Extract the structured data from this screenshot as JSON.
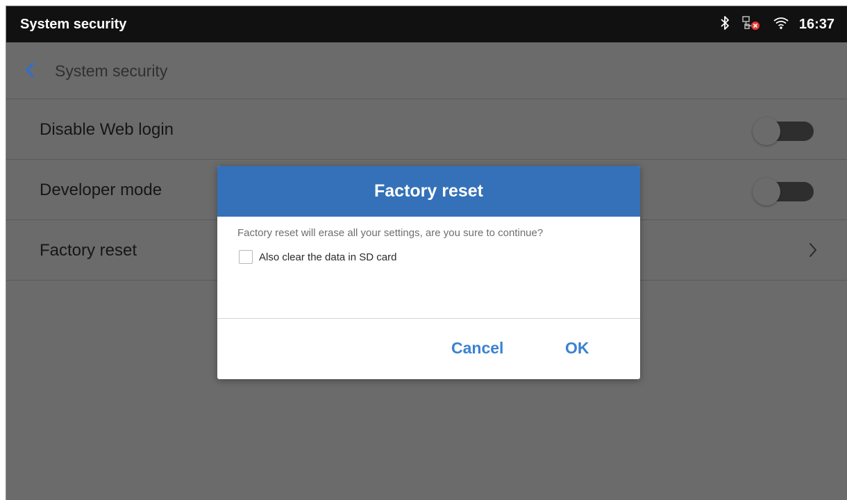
{
  "statusbar": {
    "title": "System security",
    "time": "16:37",
    "icons": [
      "bluetooth-icon",
      "network-disconnected-icon",
      "wifi-icon"
    ],
    "error_color": "#e53935"
  },
  "actionbar": {
    "back_icon": "chevron-left-icon",
    "title": "System security",
    "accent": "#2e6fd0"
  },
  "settings": [
    {
      "label": "Disable Web login",
      "control": "toggle",
      "enabled": false
    },
    {
      "label": "Developer mode",
      "control": "toggle",
      "enabled": false
    },
    {
      "label": "Factory reset",
      "control": "chevron-right-icon"
    }
  ],
  "dialog": {
    "title": "Factory reset",
    "message": "Factory reset will erase all your settings, are you sure to continue?",
    "checkbox_label": "Also clear the data in SD card",
    "checkbox_checked": false,
    "cancel_label": "Cancel",
    "ok_label": "OK",
    "header_color": "#3471b8",
    "button_color": "#3b82cf"
  }
}
